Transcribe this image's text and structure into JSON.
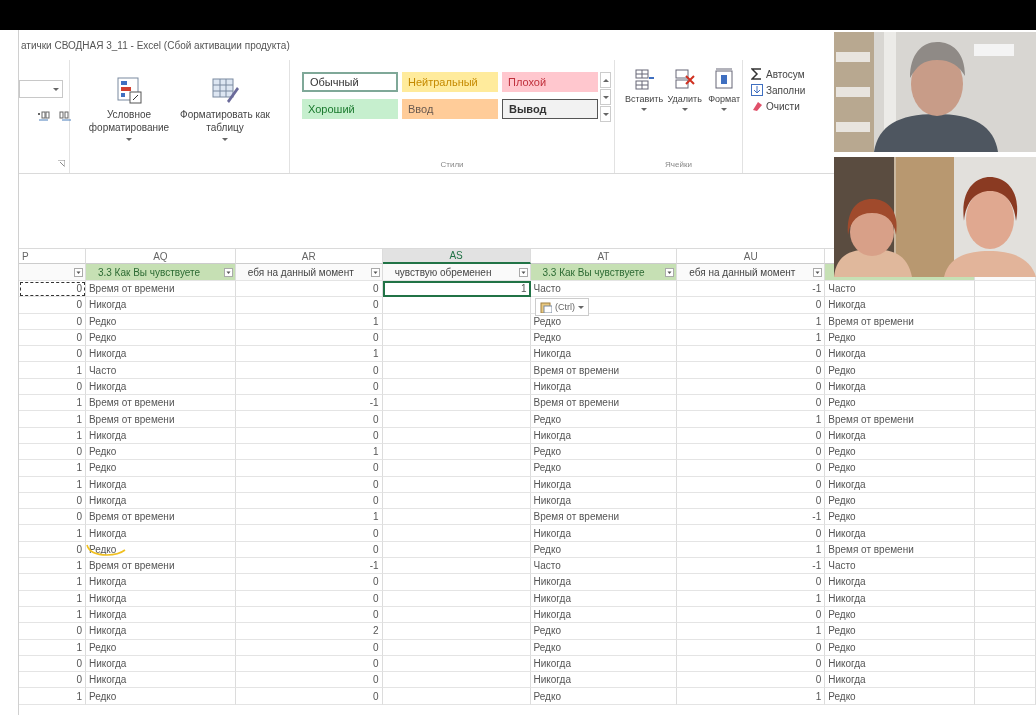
{
  "window": {
    "title": "атички СВОДНАЯ 3_11 - Excel (Сбой активации продукта)"
  },
  "ribbon": {
    "format_buttons": [
      {
        "label": "Условное форматирование",
        "kind": "conditional"
      },
      {
        "label": "Форматировать как таблицу",
        "kind": "table"
      }
    ],
    "styles": [
      {
        "label": "Обычный",
        "kind": "normal"
      },
      {
        "label": "Нейтральный",
        "kind": "neutral"
      },
      {
        "label": "Плохой",
        "kind": "bad"
      },
      {
        "label": "Хороший",
        "kind": "good"
      },
      {
        "label": "Ввод",
        "kind": "input"
      },
      {
        "label": "Вывод",
        "kind": "output"
      }
    ],
    "styles_label": "Стили",
    "cell_buttons": [
      {
        "label": "Вставить",
        "kind": "insert"
      },
      {
        "label": "Удалить",
        "kind": "delete"
      },
      {
        "label": "Формат",
        "kind": "format"
      }
    ],
    "cells_label": "Ячейки",
    "editing": [
      {
        "label": "Автосум",
        "kind": "sum"
      },
      {
        "label": "Заполни",
        "kind": "fill"
      },
      {
        "label": "Очисти",
        "kind": "clear"
      }
    ]
  },
  "sheet": {
    "columns": [
      {
        "letter": "P",
        "selected": false
      },
      {
        "letter": "AQ",
        "selected": false
      },
      {
        "letter": "AR",
        "selected": false
      },
      {
        "letter": "AS",
        "selected": true
      },
      {
        "letter": "AT",
        "selected": false
      },
      {
        "letter": "AU",
        "selected": false
      }
    ],
    "header_row": [
      {
        "kind": "plain"
      },
      {
        "text": "3.3 Как Вы чувствуете",
        "kind": "green"
      },
      {
        "text": "ебя на данный момент",
        "kind": "plain"
      },
      {
        "text": "чувствую обременен",
        "kind": "plain"
      },
      {
        "text": "3.3 Как Вы чувствуете",
        "kind": "green"
      },
      {
        "text": "ебя на данный момент",
        "kind": "plain"
      },
      {
        "kind": "green"
      },
      {
        "kind": "plain"
      }
    ],
    "rows": [
      [
        {
          "text": "0",
          "copied": true
        },
        "Время от времени",
        "0",
        {
          "text": "1",
          "selected": true
        },
        "Часто",
        "-1",
        "Часто"
      ],
      [
        "0",
        "Никогда",
        "0",
        null,
        null,
        "0",
        "Никогда"
      ],
      [
        "0",
        "Редко",
        "1",
        null,
        "Редко",
        "1",
        "Время от времени"
      ],
      [
        "0",
        "Редко",
        "0",
        null,
        "Редко",
        "1",
        "Редко"
      ],
      [
        "0",
        "Никогда",
        "1",
        null,
        "Никогда",
        "0",
        "Никогда"
      ],
      [
        "1",
        "Часто",
        "0",
        null,
        "Время от времени",
        "0",
        "Редко"
      ],
      [
        "0",
        "Никогда",
        "0",
        null,
        "Никогда",
        "0",
        "Никогда"
      ],
      [
        "1",
        "Время от времени",
        "-1",
        null,
        "Время от времени",
        "0",
        "Редко"
      ],
      [
        "1",
        "Время от времени",
        "0",
        null,
        "Редко",
        "1",
        "Время от времени"
      ],
      [
        "1",
        "Никогда",
        "0",
        null,
        "Никогда",
        "0",
        "Никогда"
      ],
      [
        "0",
        "Редко",
        "1",
        null,
        "Редко",
        "0",
        "Редко"
      ],
      [
        "1",
        "Редко",
        "0",
        null,
        "Редко",
        "0",
        "Редко"
      ],
      [
        "1",
        "Никогда",
        "0",
        null,
        "Никогда",
        "0",
        "Никогда"
      ],
      [
        "0",
        "Никогда",
        "0",
        null,
        "Никогда",
        "0",
        "Редко"
      ],
      [
        "0",
        "Время от времени",
        "1",
        null,
        "Время от времени",
        "-1",
        "Редко"
      ],
      [
        "1",
        "Никогда",
        "0",
        null,
        "Никогда",
        "0",
        "Никогда"
      ],
      [
        "0",
        "Редко",
        "0",
        null,
        "Редко",
        "1",
        "Время от времени"
      ],
      [
        "1",
        "Время от времени",
        "-1",
        null,
        "Часто",
        "-1",
        "Часто"
      ],
      [
        "1",
        "Никогда",
        "0",
        null,
        "Никогда",
        "0",
        "Никогда"
      ],
      [
        "1",
        "Никогда",
        "0",
        null,
        "Никогда",
        "1",
        "Никогда"
      ],
      [
        "1",
        "Никогда",
        "0",
        null,
        "Никогда",
        "0",
        "Редко"
      ],
      [
        "0",
        "Никогда",
        "2",
        null,
        "Редко",
        "1",
        "Редко"
      ],
      [
        "1",
        "Редко",
        "0",
        null,
        "Редко",
        "0",
        "Редко"
      ],
      [
        "0",
        "Никогда",
        "0",
        null,
        "Никогда",
        "0",
        "Никогда"
      ],
      [
        "0",
        "Никогда",
        "0",
        null,
        "Никогда",
        "0",
        "Никогда"
      ],
      [
        "1",
        "Редко",
        "0",
        null,
        "Редко",
        "1",
        "Редко"
      ]
    ],
    "paste_options": {
      "label": "(Ctrl)"
    }
  }
}
